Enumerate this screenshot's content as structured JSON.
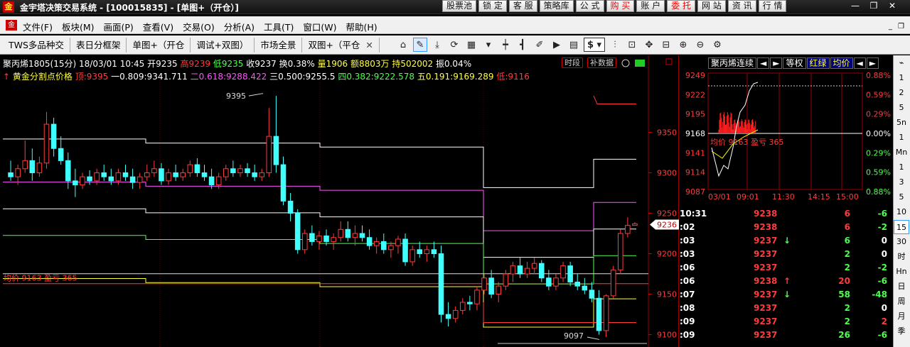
{
  "app": {
    "title": "金宇塔决策交易系统 - [100015835] - [单图+（开仓）]",
    "top_buttons": [
      "股票池",
      "锁 定",
      "客 服",
      "策略库",
      "公 式",
      "购 买",
      "账 户",
      "委 托",
      "网 站",
      "资 讯",
      "行 情"
    ],
    "hot_buttons": [
      "购 买",
      "委 托"
    ],
    "window_controls": [
      "—",
      "❐",
      "✕"
    ]
  },
  "menu": {
    "items": [
      "文件(F)",
      "板块(M)",
      "画面(P)",
      "查看(V)",
      "交易(O)",
      "分析(A)",
      "工具(T)",
      "窗口(W)",
      "帮助(H)"
    ],
    "right_controls": [
      "_",
      "❐",
      "✕"
    ]
  },
  "toolbar": {
    "tabs": [
      "TWS多品种交",
      "表日分框架",
      "单图+（开仓",
      "调试+双图）",
      "市场全景",
      "双图+（平仓"
    ],
    "close_mark": "✕",
    "icons": [
      {
        "name": "home-icon",
        "glyph": "⌂"
      },
      {
        "name": "draw-line-icon",
        "glyph": "✎",
        "sel": true
      },
      {
        "name": "download-icon",
        "glyph": "⤓"
      },
      {
        "name": "refresh-icon",
        "glyph": "⟳"
      },
      {
        "name": "grid-icon",
        "glyph": "▦"
      },
      {
        "name": "dropdown-icon",
        "glyph": "▾"
      },
      {
        "name": "candle-icon",
        "glyph": "┿"
      },
      {
        "name": "bars-icon",
        "glyph": "┫"
      },
      {
        "name": "edit-icon",
        "glyph": "✐"
      },
      {
        "name": "play-icon",
        "glyph": "▶"
      },
      {
        "name": "doc-icon",
        "glyph": "▤"
      },
      {
        "name": "dollar-icon",
        "glyph": "$ ▾"
      },
      {
        "name": "filter-icon",
        "glyph": "⫶"
      },
      {
        "name": "chart-icon",
        "glyph": "⊡"
      },
      {
        "name": "move-icon",
        "glyph": "✥"
      },
      {
        "name": "zoom-fit-icon",
        "glyph": "⊟"
      },
      {
        "name": "zoom-in-icon",
        "glyph": "⊕"
      },
      {
        "name": "zoom-out-icon",
        "glyph": "⊖"
      },
      {
        "name": "settings-icon",
        "glyph": "⚙"
      }
    ]
  },
  "chart_header": {
    "symbol": "聚丙烯1805(15分)",
    "datetime": "18/03/01 10:45",
    "open": "开9235",
    "high": "高9239",
    "low": "低9235",
    "close": "收9237",
    "turnover": "换0.38%",
    "volume": "量1906",
    "amount": "额8803万",
    "position": "持502002",
    "amplitude": "振0.04%",
    "fib_title": "黄金分割点价格",
    "fib_top": "顶:9395",
    "fib1": "一0.809:9341.711",
    "fib2": "二0.618:9288.422",
    "fib3": "三0.500:9255.5",
    "fib4": "四0.382:9222.578",
    "fib5": "五0.191:9169.289",
    "fib_low": "低:9116",
    "tags": [
      "时段",
      "补数据"
    ],
    "avg_line_label": "均价 9163 盈亏 365",
    "high_mark": "9395",
    "low_mark": "9097",
    "current_price": "9236"
  },
  "chart_data": {
    "type": "candlestick",
    "title": "聚丙烯1805(15分)",
    "ylim": [
      9090,
      9410
    ],
    "y_ticks": [
      9100,
      9150,
      9200,
      9250,
      9300,
      9350
    ],
    "avg_price": 9163,
    "candles": [
      [
        9300,
        9315,
        9290,
        9295
      ],
      [
        9295,
        9310,
        9285,
        9305
      ],
      [
        9305,
        9340,
        9300,
        9315
      ],
      [
        9315,
        9330,
        9290,
        9300
      ],
      [
        9300,
        9320,
        9295,
        9312
      ],
      [
        9312,
        9375,
        9305,
        9360
      ],
      [
        9360,
        9368,
        9320,
        9330
      ],
      [
        9330,
        9345,
        9310,
        9315
      ],
      [
        9315,
        9325,
        9280,
        9290
      ],
      [
        9290,
        9305,
        9270,
        9285
      ],
      [
        9285,
        9300,
        9280,
        9295
      ],
      [
        9295,
        9303,
        9285,
        9290
      ],
      [
        9290,
        9305,
        9285,
        9300
      ],
      [
        9300,
        9310,
        9290,
        9295
      ],
      [
        9295,
        9305,
        9285,
        9290
      ],
      [
        9290,
        9305,
        9285,
        9300
      ],
      [
        9300,
        9310,
        9290,
        9295
      ],
      [
        9295,
        9305,
        9280,
        9288
      ],
      [
        9288,
        9300,
        9280,
        9295
      ],
      [
        9295,
        9310,
        9290,
        9300
      ],
      [
        9300,
        9315,
        9295,
        9305
      ],
      [
        9305,
        9312,
        9285,
        9290
      ],
      [
        9290,
        9305,
        9285,
        9300
      ],
      [
        9300,
        9310,
        9290,
        9295
      ],
      [
        9295,
        9305,
        9290,
        9300
      ],
      [
        9300,
        9315,
        9295,
        9310
      ],
      [
        9310,
        9318,
        9295,
        9300
      ],
      [
        9300,
        9310,
        9290,
        9295
      ],
      [
        9295,
        9305,
        9280,
        9285
      ],
      [
        9285,
        9300,
        9280,
        9295
      ],
      [
        9295,
        9310,
        9290,
        9305
      ],
      [
        9305,
        9315,
        9295,
        9300
      ],
      [
        9300,
        9310,
        9295,
        9305
      ],
      [
        9305,
        9312,
        9295,
        9300
      ],
      [
        9300,
        9310,
        9290,
        9295
      ],
      [
        9295,
        9305,
        9290,
        9300
      ],
      [
        9300,
        9380,
        9295,
        9345
      ],
      [
        9345,
        9395,
        9300,
        9310
      ],
      [
        9310,
        9320,
        9260,
        9265
      ],
      [
        9265,
        9275,
        9240,
        9250
      ],
      [
        9250,
        9255,
        9200,
        9205
      ],
      [
        9205,
        9230,
        9200,
        9225
      ],
      [
        9225,
        9235,
        9210,
        9215
      ],
      [
        9215,
        9228,
        9205,
        9222
      ],
      [
        9222,
        9230,
        9210,
        9215
      ],
      [
        9215,
        9225,
        9205,
        9220
      ],
      [
        9220,
        9240,
        9215,
        9230
      ],
      [
        9230,
        9240,
        9215,
        9220
      ],
      [
        9220,
        9235,
        9210,
        9225
      ],
      [
        9225,
        9235,
        9215,
        9220
      ],
      [
        9220,
        9230,
        9205,
        9210
      ],
      [
        9210,
        9220,
        9200,
        9215
      ],
      [
        9215,
        9225,
        9200,
        9205
      ],
      [
        9205,
        9215,
        9195,
        9210
      ],
      [
        9210,
        9222,
        9200,
        9218
      ],
      [
        9218,
        9225,
        9185,
        9190
      ],
      [
        9190,
        9210,
        9185,
        9205
      ],
      [
        9205,
        9215,
        9195,
        9200
      ],
      [
        9200,
        9210,
        9190,
        9205
      ],
      [
        9205,
        9215,
        9195,
        9200
      ],
      [
        9200,
        9210,
        9115,
        9125
      ],
      [
        9125,
        9140,
        9110,
        9120
      ],
      [
        9120,
        9135,
        9115,
        9130
      ],
      [
        9130,
        9145,
        9125,
        9140
      ],
      [
        9140,
        9148,
        9130,
        9138
      ],
      [
        9138,
        9160,
        9130,
        9155
      ],
      [
        9155,
        9175,
        9150,
        9170
      ],
      [
        9170,
        9180,
        9145,
        9150
      ],
      [
        9150,
        9165,
        9140,
        9160
      ],
      [
        9160,
        9180,
        9155,
        9175
      ],
      [
        9175,
        9190,
        9165,
        9185
      ],
      [
        9185,
        9195,
        9170,
        9175
      ],
      [
        9175,
        9190,
        9170,
        9182
      ],
      [
        9182,
        9195,
        9175,
        9188
      ],
      [
        9188,
        9192,
        9165,
        9170
      ],
      [
        9170,
        9180,
        9155,
        9160
      ],
      [
        9160,
        9175,
        9155,
        9170
      ],
      [
        9170,
        9190,
        9165,
        9185
      ],
      [
        9185,
        9190,
        9160,
        9165
      ],
      [
        9165,
        9175,
        9155,
        9160
      ],
      [
        9160,
        9170,
        9150,
        9155
      ],
      [
        9155,
        9165,
        9140,
        9145
      ],
      [
        9145,
        9155,
        9100,
        9105
      ],
      [
        9105,
        9150,
        9097,
        9148
      ],
      [
        9148,
        9185,
        9145,
        9180
      ],
      [
        9180,
        9230,
        9175,
        9225
      ],
      [
        9225,
        9245,
        9220,
        9235
      ],
      [
        9235,
        9239,
        9235,
        9237
      ]
    ],
    "fib_levels": [
      {
        "name": "顶",
        "value": 9395,
        "color": "#ff3c3c"
      },
      {
        "name": "一",
        "value": 9341.711,
        "color": "#ffffff"
      },
      {
        "name": "二",
        "value": 9288.422,
        "color": "#ff55ff"
      },
      {
        "name": "三",
        "value": 9255.5,
        "color": "#ffffff"
      },
      {
        "name": "四",
        "value": 9222.578,
        "color": "#4cff4c"
      },
      {
        "name": "五",
        "value": 9169.289,
        "color": "#ffff40"
      },
      {
        "name": "低",
        "value": 9116,
        "color": "#ff3c3c"
      }
    ]
  },
  "mini_chart": {
    "tabs": [
      "聚丙烯连续",
      "◄",
      "►",
      "等权",
      "红绿",
      "均价",
      "◄",
      "►"
    ],
    "active_tabs": [
      "红绿",
      "均价"
    ],
    "left_axis": [
      "9249",
      "9222",
      "9195",
      "9168",
      "9141",
      "9114",
      "9087"
    ],
    "right_axis": [
      "0.88%",
      "0.59%",
      "0.29%",
      "0.00%",
      "0.29%",
      "0.59%",
      "0.88%"
    ],
    "time_axis": [
      "03/01",
      "09:01",
      "11:30",
      "14:15",
      "15:00"
    ],
    "avg_label": "均价 9163 盈亏 365"
  },
  "ticks": [
    {
      "time": "10:31",
      "price": "9238",
      "arrow": "",
      "vol": "6",
      "chg": "-6",
      "chg_color": "g"
    },
    {
      "time": ":02",
      "price": "9238",
      "arrow": "",
      "vol": "6",
      "chg": "-2",
      "chg_color": "g"
    },
    {
      "time": ":03",
      "price": "9237",
      "arrow": "↓",
      "vol": "6",
      "chg": "0",
      "chg_color": "w"
    },
    {
      "time": ":03",
      "price": "9237",
      "arrow": "",
      "vol": "2",
      "chg": "0",
      "chg_color": "w"
    },
    {
      "time": ":06",
      "price": "9237",
      "arrow": "",
      "vol": "2",
      "chg": "-2",
      "chg_color": "g"
    },
    {
      "time": ":06",
      "price": "9238",
      "arrow": "↑",
      "vol": "20",
      "chg": "-6",
      "chg_color": "g"
    },
    {
      "time": ":07",
      "price": "9237",
      "arrow": "↓",
      "vol": "58",
      "chg": "-48",
      "chg_color": "g"
    },
    {
      "time": ":08",
      "price": "9237",
      "arrow": "",
      "vol": "2",
      "chg": "0",
      "chg_color": "w"
    },
    {
      "time": ":09",
      "price": "9237",
      "arrow": "",
      "vol": "2",
      "chg": "2",
      "chg_color": "r"
    },
    {
      "time": ":09",
      "price": "9237",
      "arrow": "",
      "vol": "26",
      "chg": "-6",
      "chg_color": "g"
    }
  ],
  "sidebar": [
    "⌁",
    "1",
    "2",
    "5",
    "5n",
    "1",
    "Mn",
    "1",
    "3",
    "5",
    "10",
    "15",
    "30",
    "时",
    "Hn",
    "日",
    "周",
    "月",
    "季"
  ]
}
